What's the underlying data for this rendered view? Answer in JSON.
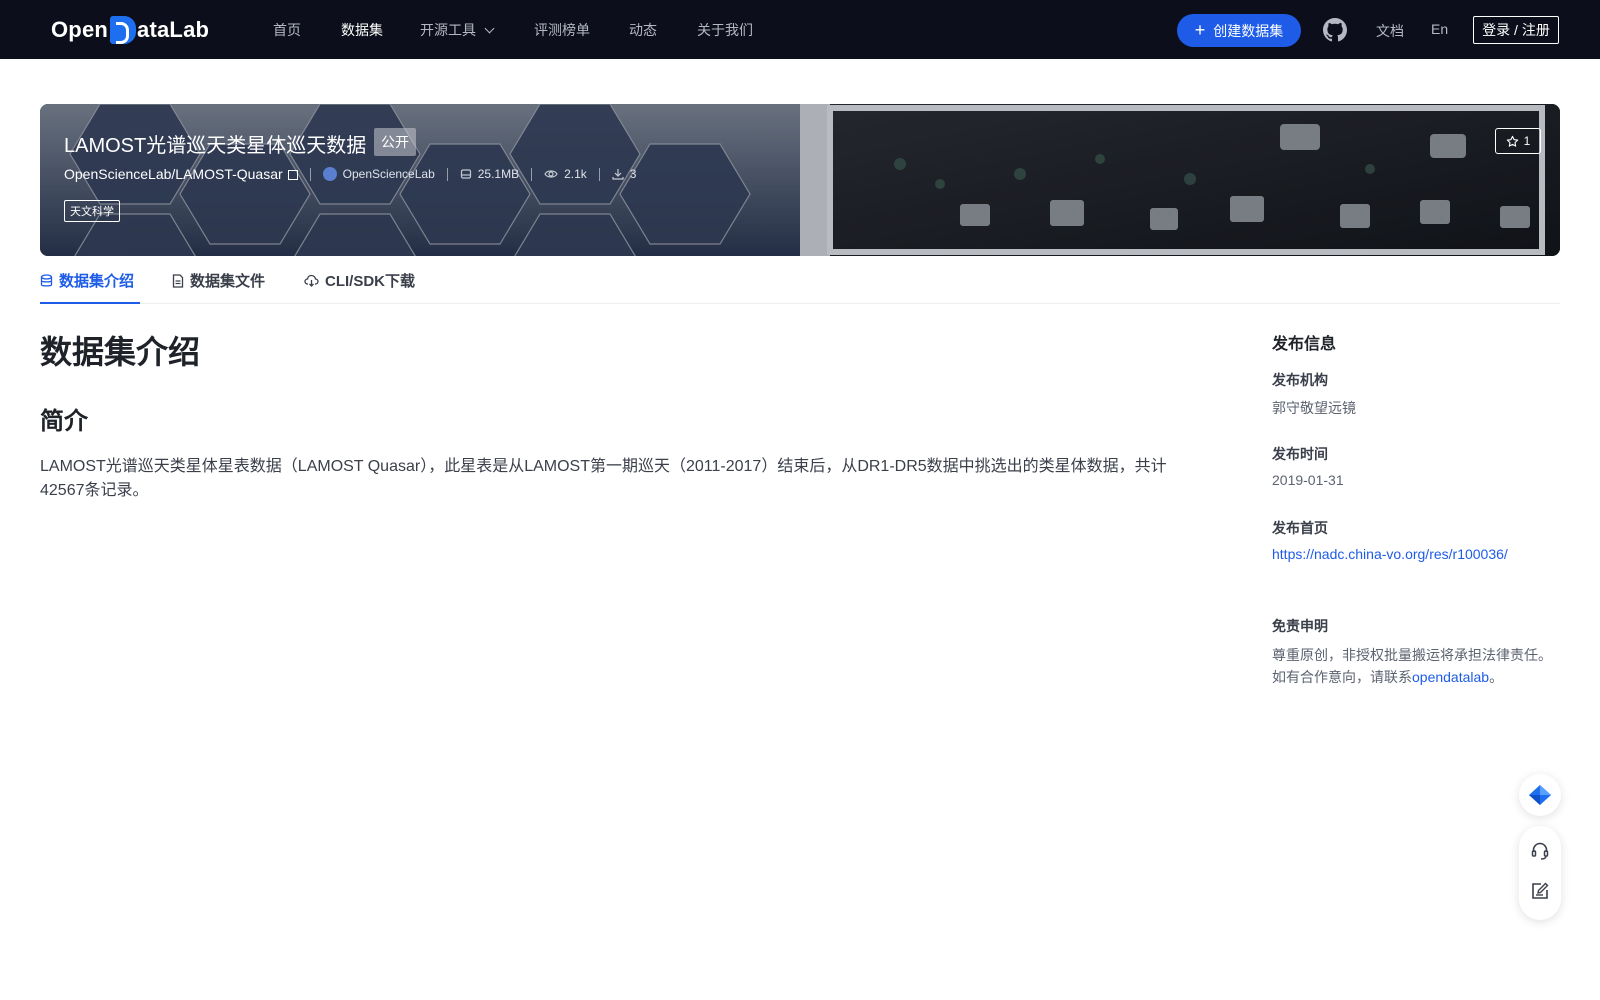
{
  "nav": {
    "logo_text_left": "Open",
    "logo_text_right": "ataLab",
    "items": [
      {
        "label": "首页",
        "active": false
      },
      {
        "label": "数据集",
        "active": true
      },
      {
        "label": "开源工具",
        "active": false,
        "has_dropdown": true
      },
      {
        "label": "评测榜单",
        "active": false
      },
      {
        "label": "动态",
        "active": false
      },
      {
        "label": "关于我们",
        "active": false
      }
    ],
    "create_label": "创建数据集",
    "doc_label": "文档",
    "lang_label": "En",
    "login_label": "登录 / 注册",
    "accent": "#1e5ce8"
  },
  "dataset": {
    "title": "LAMOST光谱巡天类星体巡天数据",
    "visibility": "公开",
    "path": "OpenScienceLab/LAMOST-Quasar",
    "org": "OpenScienceLab",
    "size": "25.1MB",
    "views": "2.1k",
    "downloads": "3",
    "tag": "天文科学",
    "stars": "1"
  },
  "tabs": [
    {
      "label": "数据集介绍",
      "icon": "database-icon",
      "active": true
    },
    {
      "label": "数据集文件",
      "icon": "file-icon",
      "active": false
    },
    {
      "label": "CLI/SDK下载",
      "icon": "cloud-download-icon",
      "active": false
    }
  ],
  "main": {
    "heading": "数据集介绍",
    "subheading": "简介",
    "intro": "LAMOST光谱巡天类星体星表数据（LAMOST Quasar），此星表是从LAMOST第一期巡天（2011-2017）结束后，从DR1-DR5数据中挑选出的类星体数据，共计42567条记录。"
  },
  "sidebar": {
    "heading": "发布信息",
    "publisher_label": "发布机构",
    "publisher": "郭守敬望远镜",
    "date_label": "发布时间",
    "date": "2019-01-31",
    "homepage_label": "发布首页",
    "homepage": "https://nadc.china-vo.org/res/r100036/",
    "disclaimer_label": "免责申明",
    "disclaimer_line1": "尊重原创，非授权批量搬运将承担法律责任。",
    "disclaimer_line2_prefix": "如有合作意向，请联系",
    "disclaimer_link": "opendatalab",
    "disclaimer_suffix": "。"
  }
}
